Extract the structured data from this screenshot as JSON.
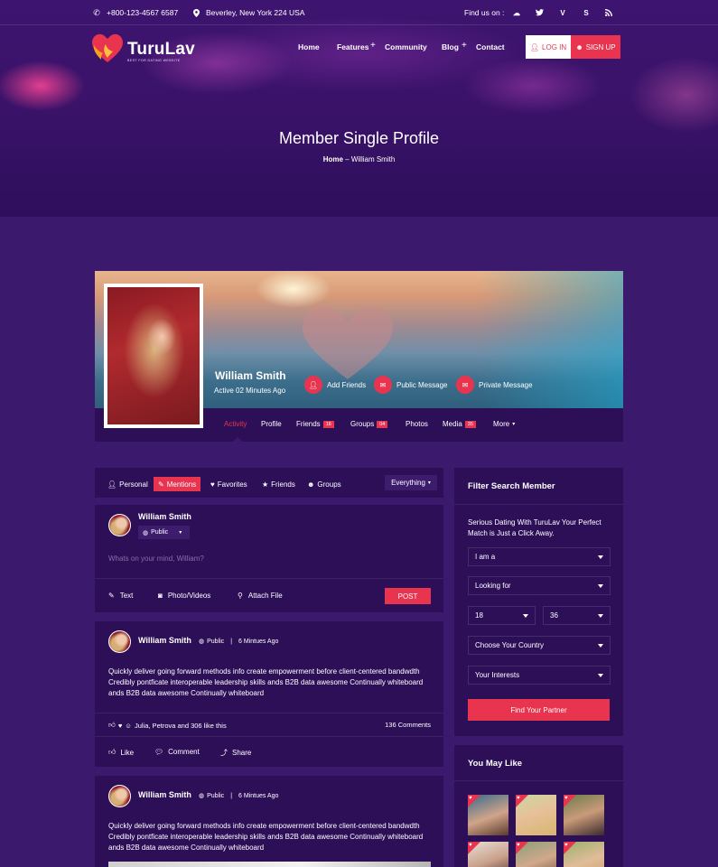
{
  "topbar": {
    "phone": "+800-123-4567 6587",
    "address": "Beverley, New York 224 USA",
    "find_us": "Find us on :",
    "socials": [
      "messenger-icon",
      "twitter-icon",
      "vimeo-icon",
      "skype-icon",
      "rss-icon"
    ]
  },
  "brand": {
    "name": "TuruLav",
    "tagline": "BEST FOR DATING WEBSITE"
  },
  "nav": {
    "items": [
      "Home",
      "Features",
      "Community",
      "Blog",
      "Contact"
    ],
    "login": "LOG IN",
    "signup": "SIGN UP"
  },
  "hero": {
    "title": "Member Single Profile",
    "crumb_home": "Home",
    "crumb_sep": "–",
    "crumb_current": "William Smith"
  },
  "profile": {
    "name": "William Smith",
    "status": "Active 02 Minutes Ago",
    "actions": [
      "Add Friends",
      "Public Message",
      "Private Message"
    ],
    "tabs": [
      {
        "label": "Activity",
        "badge": ""
      },
      {
        "label": "Profile",
        "badge": ""
      },
      {
        "label": "Friends",
        "badge": "16"
      },
      {
        "label": "Groups",
        "badge": "04"
      },
      {
        "label": "Photos",
        "badge": ""
      },
      {
        "label": "Media",
        "badge": "35"
      },
      {
        "label": "More",
        "badge": ""
      }
    ]
  },
  "feed_filter": {
    "tabs": [
      "Personal",
      "Mentions",
      "Favorites",
      "Friends",
      "Groups"
    ],
    "select": "Everything"
  },
  "composer": {
    "user": "William Smith",
    "privacy": "Public",
    "placeholder": "Whats on your mind, William?",
    "tools": [
      "Text",
      "Photo/Videos",
      "Attach File"
    ],
    "post": "POST"
  },
  "posts": [
    {
      "user": "William Smith",
      "privacy": "Public",
      "sep": "|",
      "time": "6 Mintues Ago",
      "text": [
        "Quickly deliver going forward methods info create empowerment before client-centered bandwdth",
        "Credibly pontficate interoperable leadership skills ands B2B data awesome Continually whiteboard",
        "ands B2B data awesome Continually whiteboard"
      ],
      "likes": "Julia, Petrova and 306 like this",
      "comments": "136 Comments",
      "actions": [
        "Like",
        "Comment",
        "Share"
      ]
    },
    {
      "user": "William Smith",
      "privacy": "Public",
      "sep": "|",
      "time": "6 Mintues Ago",
      "text": [
        "Quickly deliver going forward methods info create empowerment before client-centered bandwdth",
        "Credibly pontficate interoperable leadership skills ands B2B data awesome Continually whiteboard",
        "ands B2B data awesome Continually whiteboard"
      ]
    }
  ],
  "filter": {
    "title": "Filter Search Member",
    "subtitle_lines": [
      "Serious Dating With TuruLav Your Perfect",
      "Match is Just a Click Away."
    ],
    "i_am": "I am a",
    "looking_for": "Looking for",
    "age_from": "18",
    "age_to": "36",
    "country": "Choose Your Country",
    "interests": "Your Interests",
    "button": "Find Your Partner"
  },
  "may_like": {
    "title": "You May Like"
  },
  "colors": {
    "accent": "#e8344f",
    "bg": "#3b1a6e",
    "panel": "#2d0f58"
  }
}
